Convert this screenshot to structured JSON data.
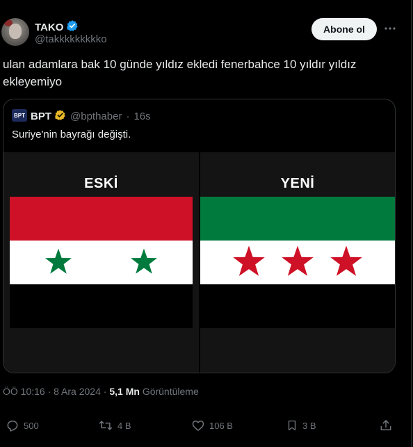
{
  "author": {
    "display_name": "TAKO",
    "handle": "@takkkkkkkkko",
    "verified_badge_color": "#1d9bf0"
  },
  "follow_button_label": "Abone ol",
  "more_icon": "ellipsis-icon",
  "tweet_text": "ulan adamlara bak 10 günde yıldız ekledi fenerbahce 10 yıldır yıldız ekleyemiyo",
  "quoted": {
    "logo_text": "BPT",
    "display_name": "BPT",
    "handle": "@bpthaber",
    "time": "16s",
    "verified_badge_color": "#e8b829",
    "text": "Suriye'nin bayrağı değişti.",
    "media": {
      "left_title": "ESKİ",
      "right_title": "YENİ",
      "old_flag_colors": {
        "top": "#ce1126",
        "middle": "#ffffff",
        "bottom": "#000000",
        "stars": "#007a3d"
      },
      "new_flag_colors": {
        "top": "#007a3d",
        "middle": "#ffffff",
        "bottom": "#000000",
        "stars": "#ce1126"
      }
    }
  },
  "meta": {
    "time": "ÖÖ 10:16",
    "date": "8 Ara 2024",
    "views_count": "5,1 Mn",
    "views_label": "Görüntüleme",
    "separator": "·"
  },
  "actions": {
    "replies": "500",
    "reposts": "4 B",
    "likes": "106 B",
    "bookmarks": "3 B"
  },
  "colors": {
    "background": "#000000",
    "text": "#e7e9ea",
    "muted": "#71767b",
    "border": "#2f3336"
  }
}
